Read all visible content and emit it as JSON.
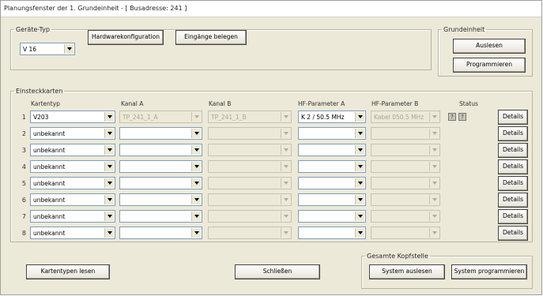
{
  "window": {
    "title": "Planungsfenster der 1. Grundeinheit - [ Busadresse: 241 ]"
  },
  "geraete_typ": {
    "legend": "Geräte-Typ",
    "value": "V 16",
    "hardware_button": "Hardwarekonfiguration",
    "eingaenge_button": "Eingänge belegen"
  },
  "grundeinheit": {
    "legend": "Grundeinheit",
    "auslesen_button": "Auslesen",
    "programmieren_button": "Programmieren"
  },
  "einsteckkarten": {
    "legend": "Einsteckkarten",
    "headers": {
      "kartentyp": "Kartentyp",
      "kanal_a": "Kanal A",
      "kanal_b": "Kanal B",
      "hf_a": "HF-Parameter A",
      "hf_b": "HF-Parameter B",
      "status": "Status"
    },
    "details_label": "Details",
    "status_q": "?",
    "rows": [
      {
        "num": "1",
        "kartentyp": "V203",
        "kanal_a": "TP_241_1_A",
        "kanal_b": "TP_241_1_B",
        "hf_a": "K 2 / 50.5 MHz",
        "hf_b": "Kabel 050.5 MHz"
      },
      {
        "num": "2",
        "kartentyp": "unbekannt",
        "kanal_a": "",
        "kanal_b": "",
        "hf_a": "",
        "hf_b": ""
      },
      {
        "num": "3",
        "kartentyp": "unbekannt",
        "kanal_a": "",
        "kanal_b": "",
        "hf_a": "",
        "hf_b": ""
      },
      {
        "num": "4",
        "kartentyp": "unbekannt",
        "kanal_a": "",
        "kanal_b": "",
        "hf_a": "",
        "hf_b": ""
      },
      {
        "num": "5",
        "kartentyp": "unbekannt",
        "kanal_a": "",
        "kanal_b": "",
        "hf_a": "",
        "hf_b": ""
      },
      {
        "num": "6",
        "kartentyp": "unbekannt",
        "kanal_a": "",
        "kanal_b": "",
        "hf_a": "",
        "hf_b": ""
      },
      {
        "num": "7",
        "kartentyp": "unbekannt",
        "kanal_a": "",
        "kanal_b": "",
        "hf_a": "",
        "hf_b": ""
      },
      {
        "num": "8",
        "kartentyp": "unbekannt",
        "kanal_a": "",
        "kanal_b": "",
        "hf_a": "",
        "hf_b": ""
      }
    ]
  },
  "bottom": {
    "kartentypen_button": "Kartentypen lesen",
    "schliessen_button": "Schließen",
    "gesamte_legend": "Gesamte Kopfstelle",
    "system_auslesen_button": "System auslesen",
    "system_programmieren_button": "System programmieren"
  }
}
